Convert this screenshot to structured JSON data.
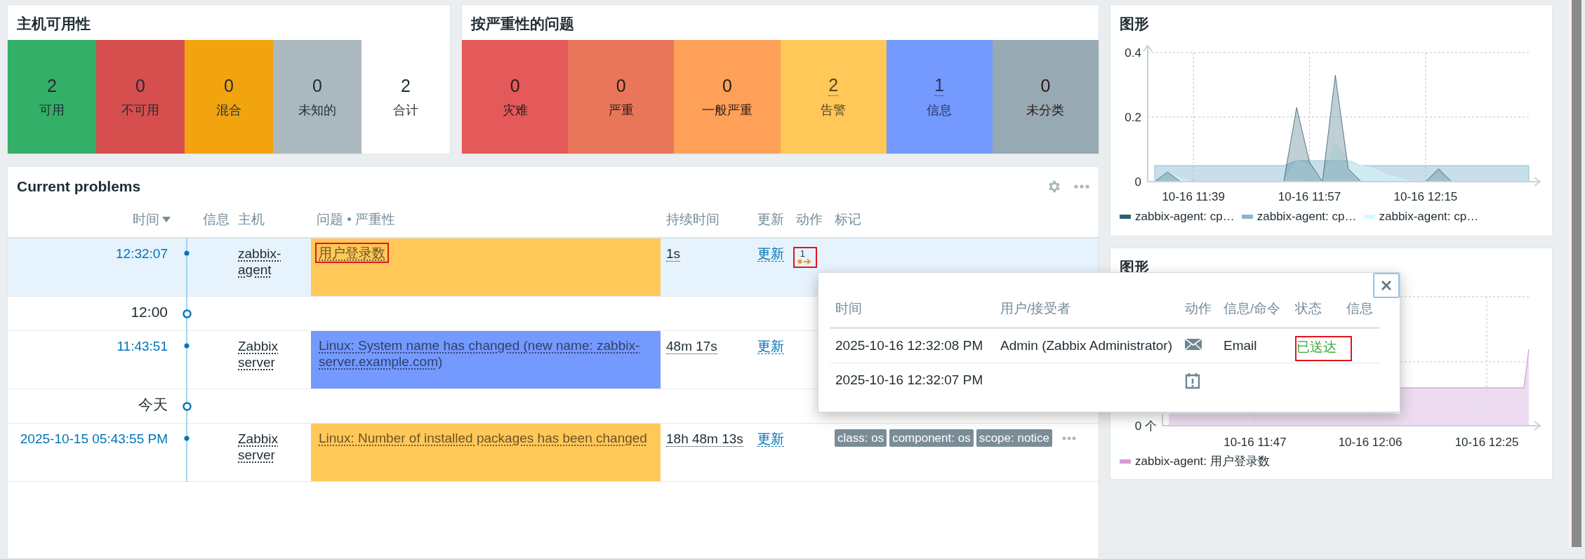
{
  "host_availability": {
    "title": "主机可用性",
    "tiles": [
      {
        "kind": "available",
        "count": "2",
        "label": "可用"
      },
      {
        "kind": "unavailable",
        "count": "0",
        "label": "不可用"
      },
      {
        "kind": "mixed",
        "count": "0",
        "label": "混合"
      },
      {
        "kind": "unknown",
        "count": "0",
        "label": "未知的"
      },
      {
        "kind": "total",
        "count": "2",
        "label": "合计"
      }
    ]
  },
  "problems_by_severity": {
    "title": "按严重性的问题",
    "tiles": [
      {
        "color": "#e45959",
        "count": "0",
        "label": "灾难",
        "link": false
      },
      {
        "color": "#e97659",
        "count": "0",
        "label": "严重",
        "link": false
      },
      {
        "color": "#ffa059",
        "count": "0",
        "label": "一般严重",
        "link": false
      },
      {
        "color": "#ffc859",
        "count": "2",
        "label": "告警",
        "link": true
      },
      {
        "color": "#7499ff",
        "count": "1",
        "label": "信息",
        "link": true
      },
      {
        "color": "#97aab3",
        "count": "0",
        "label": "未分类",
        "link": false
      }
    ]
  },
  "graph_1": {
    "title": "图形",
    "chart_data": {
      "type": "area",
      "categories": [
        null,
        null,
        null,
        "10-16 11:39",
        null,
        null,
        null,
        null,
        null,
        null,
        null,
        null,
        "10-16 11:57",
        null,
        null,
        null,
        null,
        null,
        null,
        null,
        null,
        "10-16 12:15",
        null,
        null,
        null,
        null,
        null,
        null,
        null,
        null
      ],
      "ylim": [
        0,
        0.4
      ],
      "yticks": [
        0,
        0.2,
        0.4
      ],
      "grid": true,
      "series": [
        {
          "name": "zabbix-agent: cp…",
          "color": "#2f5f73",
          "values": [
            0,
            0.03,
            0,
            0,
            0,
            0,
            0,
            0,
            0,
            0,
            0,
            0.23,
            0.06,
            0,
            0.33,
            0.04,
            0,
            0,
            0,
            0,
            0,
            0,
            0.04,
            0,
            0,
            0,
            0,
            0,
            0,
            0
          ]
        },
        {
          "name": "zabbix-agent: cp…",
          "color": "#86b7d0",
          "values": [
            0.05,
            0.05,
            0.05,
            0.05,
            0.05,
            0.05,
            0.05,
            0.05,
            0.05,
            0.05,
            0.05,
            0.065,
            0.065,
            0.065,
            0.065,
            0.065,
            0.05,
            0.05,
            0.05,
            0.05,
            0.05,
            0.05,
            0.05,
            0.05,
            0.05,
            0.05,
            0.05,
            0.05,
            0.05,
            0.05
          ]
        },
        {
          "name": "zabbix-agent: cp…",
          "color": "#d6f9fb",
          "values": [
            0,
            0.03,
            0.01,
            0,
            0,
            0,
            0,
            0,
            0,
            0,
            0,
            0.065,
            0.05,
            0,
            0.12,
            0.07,
            0.05,
            0.04,
            0.02,
            0.01,
            0,
            0,
            0.025,
            0,
            0,
            0,
            0,
            0,
            0,
            0
          ]
        }
      ]
    }
  },
  "graph_2": {
    "title": "图形",
    "y_tick": "0 个",
    "x_ticks": [
      "10-16 11:47",
      "10-16 12:06",
      "10-16 12:25"
    ],
    "legend": [
      {
        "name": "zabbix-agent: 用户登录数",
        "color": "#d79ad8"
      }
    ]
  },
  "current_problems": {
    "title": "Current problems",
    "columns": [
      {
        "label": "时间",
        "sorted": true
      },
      {
        "label": "信息"
      },
      {
        "label": "主机"
      },
      {
        "label": "问题 • 严重性"
      },
      {
        "label": "持续时间"
      },
      {
        "label": "更新"
      },
      {
        "label": "动作"
      },
      {
        "label": "标记"
      }
    ],
    "rows": [
      {
        "kind": "event",
        "selected": true,
        "time": "12:32:07",
        "host": "zabbix-agent",
        "problem": "用户登录数",
        "color": "#ffc859",
        "problem_annotated": true,
        "duration": "1s",
        "update": "更新",
        "actions_count": "1",
        "actions_annotated": true,
        "tags": []
      },
      {
        "kind": "separator",
        "label": "12:00"
      },
      {
        "kind": "event",
        "selected": false,
        "time": "11:43:51",
        "host": "Zabbix server",
        "problem": "Linux: System name has changed (new name: zabbix-server.example.com)",
        "color": "#7499ff",
        "problem_annotated": false,
        "duration": "48m 17s",
        "update": "更新",
        "tags": []
      },
      {
        "kind": "separator",
        "label": "今天"
      },
      {
        "kind": "event",
        "selected": false,
        "time": "2025-10-15 05:43:55 PM",
        "host": "Zabbix server",
        "problem": "Linux: Number of installed packages has been changed",
        "color": "#ffc859",
        "problem_annotated": false,
        "duration": "18h 48m 13s",
        "update": "更新",
        "tags": [
          "class: os",
          "component: os",
          "scope: notice"
        ],
        "more_tags": true
      }
    ]
  },
  "actions_popup": {
    "columns": [
      "时间",
      "用户/接受者",
      "动作",
      "信息/命令",
      "状态",
      "信息"
    ],
    "rows": [
      {
        "kind": "email",
        "time": "2025-10-16 12:32:08 PM",
        "user": "Admin (Zabbix Administrator)",
        "message": "Email",
        "status": "已送达",
        "color": "#3ca842",
        "status_annotated": true
      },
      {
        "kind": "event",
        "time": "2025-10-16 12:32:07 PM"
      }
    ]
  }
}
